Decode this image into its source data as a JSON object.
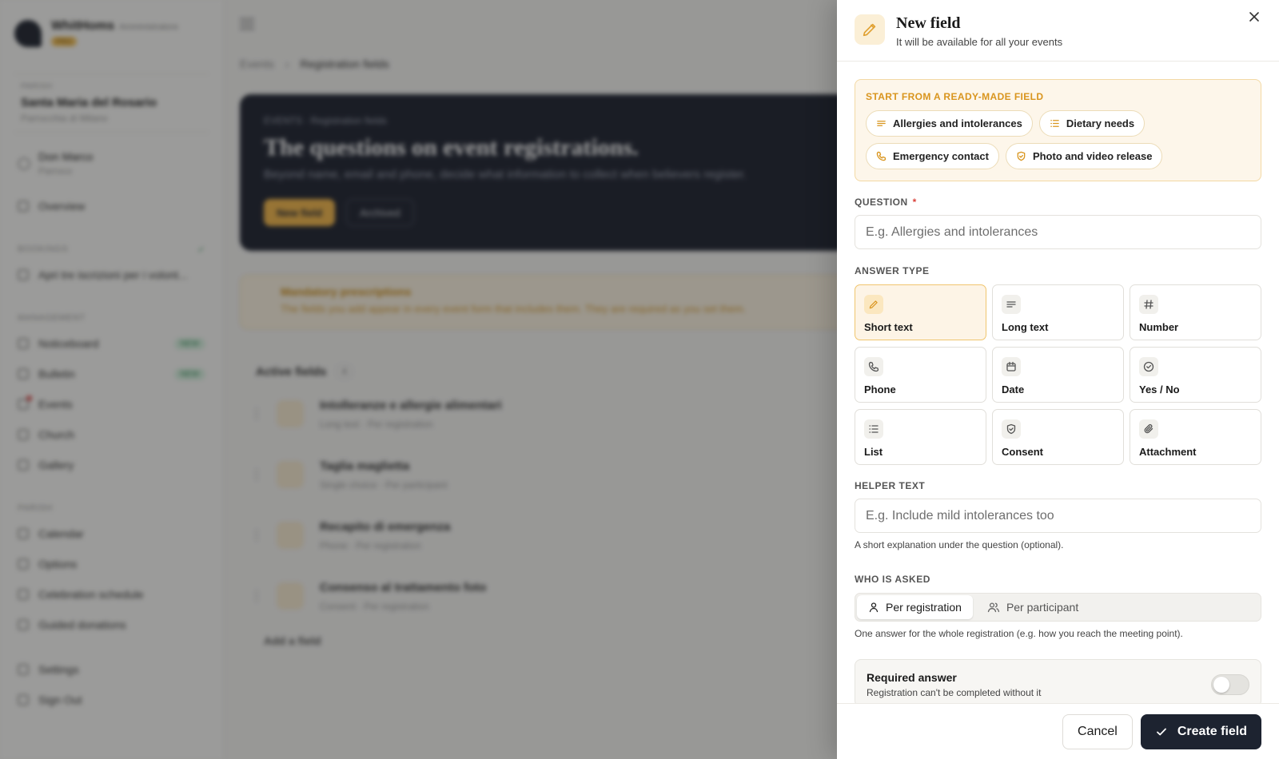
{
  "background": {
    "brand": {
      "name": "WhitHoms",
      "sub": "Amministratore",
      "badge": "PRO"
    },
    "parish": {
      "label": "PARISH",
      "name": "Santa Maria del Rosario",
      "location": "Parrocchia di Milano"
    },
    "user": {
      "name": "Don Marco",
      "role": "Parroco"
    },
    "nav_top": [
      {
        "label": "Overview"
      }
    ],
    "section_1": "BOOKINGS",
    "section_1_item": "Apri tre iscrizioni per i volont...",
    "section_2": "MANAGEMENT",
    "nav_mid": [
      {
        "label": "Noticeboard",
        "badge": "NEW"
      },
      {
        "label": "Bulletin",
        "badge": "NEW"
      },
      {
        "label": "Events",
        "badge": ""
      },
      {
        "label": "Church",
        "badge": ""
      },
      {
        "label": "Gallery",
        "badge": ""
      }
    ],
    "section_3": "PARISH",
    "nav_low": [
      {
        "label": "Calendar"
      },
      {
        "label": "Options"
      },
      {
        "label": "Celebration schedule"
      },
      {
        "label": "Guided donations"
      }
    ],
    "nav_bottom": [
      {
        "label": "Settings"
      },
      {
        "label": "Sign Out"
      }
    ],
    "breadcrumb": {
      "parent": "Events",
      "current": "Registration fields"
    },
    "hero": {
      "eyebrow": "EVENTS · Registration fields",
      "title": "The questions on event registrations.",
      "subtitle": "Beyond name, email and phone, decide what information to collect when believers register.",
      "primary": "New field",
      "secondary": "Archived"
    },
    "notice": {
      "title": "Mandatory prescriptions",
      "text": "The fields you add appear in every event form that includes them. They are required as you set them."
    },
    "fields_heading": "Active fields",
    "fields_count": "4",
    "fields": [
      {
        "name": "Intolleranze e allergie alimentari",
        "type": "Long text",
        "scope": "Per registration"
      },
      {
        "name": "Taglia maglietta",
        "type": "Single choice",
        "scope": "Per participant"
      },
      {
        "name": "Recapito di emergenza",
        "type": "Phone",
        "scope": "Per registration"
      },
      {
        "name": "Consenso al trattamento foto",
        "type": "Consent",
        "scope": "Per registration"
      }
    ],
    "add_field": "Add a field"
  },
  "drawer": {
    "title": "New field",
    "subtitle": "It will be available for all your events",
    "ready_title": "START FROM A READY-MADE FIELD",
    "chips": [
      {
        "label": "Allergies and intolerances",
        "icon": "lines-icon"
      },
      {
        "label": "Dietary needs",
        "icon": "list-icon"
      },
      {
        "label": "Emergency contact",
        "icon": "phone-icon"
      },
      {
        "label": "Photo and video release",
        "icon": "shield-check-icon"
      }
    ],
    "question_label": "QUESTION",
    "question_required_mark": "*",
    "question_placeholder": "E.g. Allergies and intolerances",
    "answer_type_label": "ANSWER TYPE",
    "answer_types": [
      {
        "label": "Short text",
        "icon": "pencil-icon",
        "selected": true
      },
      {
        "label": "Long text",
        "icon": "lines-icon",
        "selected": false
      },
      {
        "label": "Number",
        "icon": "hash-icon",
        "selected": false
      },
      {
        "label": "Phone",
        "icon": "phone-icon",
        "selected": false
      },
      {
        "label": "Date",
        "icon": "calendar-icon",
        "selected": false
      },
      {
        "label": "Yes / No",
        "icon": "check-circle-icon",
        "selected": false
      },
      {
        "label": "List",
        "icon": "list-icon",
        "selected": false
      },
      {
        "label": "Consent",
        "icon": "shield-check-icon",
        "selected": false
      },
      {
        "label": "Attachment",
        "icon": "paperclip-icon",
        "selected": false
      }
    ],
    "helper_label": "HELPER TEXT",
    "helper_placeholder": "E.g. Include mild intolerances too",
    "helper_hint": "A short explanation under the question (optional).",
    "who_label": "WHO IS ASKED",
    "who_options": [
      {
        "label": "Per registration",
        "icon": "user-icon",
        "active": true
      },
      {
        "label": "Per participant",
        "icon": "users-icon",
        "active": false
      }
    ],
    "who_hint": "One answer for the whole registration (e.g. how you reach the meeting point).",
    "required_title": "Required answer",
    "required_sub": "Registration can't be completed without it",
    "required_on": false,
    "cancel": "Cancel",
    "create": "Create field"
  },
  "colors": {
    "accent": "#f3b74a",
    "dark": "#1d2330",
    "ready_bg": "#fdf6ea"
  }
}
